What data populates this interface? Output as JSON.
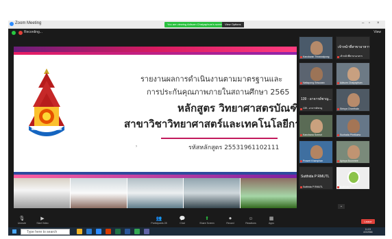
{
  "window": {
    "title": "Zoom Meeting",
    "share_banner": "You are viewing Adisorn Chaiyaphum's screen",
    "stop_share": "View Options"
  },
  "topbar": {
    "recording_label": "Recording...",
    "view_label": "View"
  },
  "slide": {
    "line1": "รายงานผลการดำเนินงานตามมาตรฐานและ",
    "line2": "การประกันคุณภาพภายในสถานศึกษา 2565",
    "line3": "หลักสูตร วิทยาศาสตรบัณฑิต",
    "line4": "สาขาวิชาวิทยาศาสตร์และเทคโนโลยีการอาหาร",
    "course_code": "รหัสหลักสูตร 25531961102111",
    "arrow": "›"
  },
  "gallery": [
    {
      "name": "Kanokwan Thirawatpong",
      "type": "face"
    },
    {
      "name": "เจ้าหน้าที่สาขาอาหาร",
      "type": "text",
      "text": "เจ้าหน้าที่สาขาอาหาร..."
    },
    {
      "name": "Nattapong Srisuwan",
      "type": "face"
    },
    {
      "name": "Adisorn Chaiyaphum",
      "type": "face"
    },
    {
      "name": "139 - อาจารย์ชาญ",
      "type": "text",
      "text": "139 - อาจารย์ชาญ..."
    },
    {
      "name": "Sirinya Chanthala",
      "type": "face"
    },
    {
      "name": "Kanchana Sornsri",
      "type": "face"
    },
    {
      "name": "Suchada Phetkaew",
      "type": "face"
    },
    {
      "name": "Prasert Khamphan",
      "type": "face"
    },
    {
      "name": "Apinya Boonmee",
      "type": "face"
    },
    {
      "name": "Sutthida P RMUTL",
      "type": "text",
      "text": "Sutthida P RMUTL"
    },
    {
      "name": "Sutthida P",
      "type": "logo"
    }
  ],
  "controls": [
    {
      "label": "Unmute",
      "icon": "microphone-icon"
    },
    {
      "label": "Start Video",
      "icon": "video-icon"
    },
    {
      "label": "Participants",
      "icon": "participants-icon",
      "count": "28"
    },
    {
      "label": "Chat",
      "icon": "chat-icon"
    },
    {
      "label": "Share Screen",
      "icon": "share-screen-icon"
    },
    {
      "label": "Record",
      "icon": "record-icon"
    },
    {
      "label": "Reactions",
      "icon": "reactions-icon"
    },
    {
      "label": "Apps",
      "icon": "apps-icon"
    }
  ],
  "end_button": "Leave",
  "taskbar": {
    "search_placeholder": "Type here to search",
    "time": "11:03",
    "date": "4/3/2566"
  },
  "colors": {
    "zoom_green": "#29c13f",
    "zoom_red": "#e0413a",
    "slide_magenta": "#d81b60",
    "slide_purple": "#6b1e7a"
  }
}
